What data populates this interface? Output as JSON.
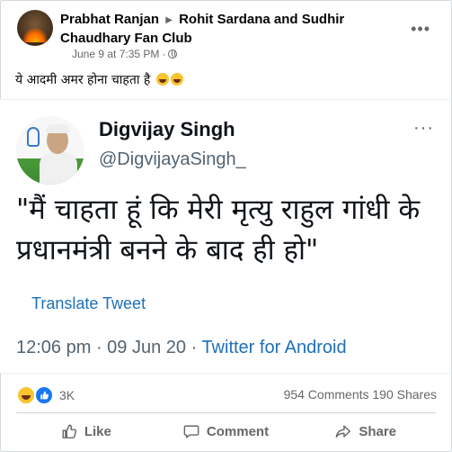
{
  "post": {
    "author": "Prabhat Ranjan",
    "group": "Rohit Sardana and Sudhir Chaudhary Fan Club",
    "timestamp": "June 9 at 7:35 PM",
    "separator": "·",
    "more_label": "•••",
    "caption": "ये आदमी अमर होना चाहता है"
  },
  "tweet": {
    "name": "Digvijay Singh",
    "handle": "@DigvijayaSingh_",
    "more_label": "···",
    "text": "\"मैं चाहता हूं कि मेरी मृत्यु राहुल गांधी के प्रधानमंत्री बनने के बाद ही हो\"",
    "translate": "Translate Tweet",
    "time": "12:06 pm · 09 Jun 20 · ",
    "source": "Twitter for Android"
  },
  "stats": {
    "reactions_count": "3K",
    "comments": "954 Comments",
    "shares": "190 Shares"
  },
  "actions": {
    "like": "Like",
    "comment": "Comment",
    "share": "Share"
  },
  "colors": {
    "accent": "#1877f2",
    "twitter_link": "#1d6fb8",
    "muted": "#65676b"
  }
}
